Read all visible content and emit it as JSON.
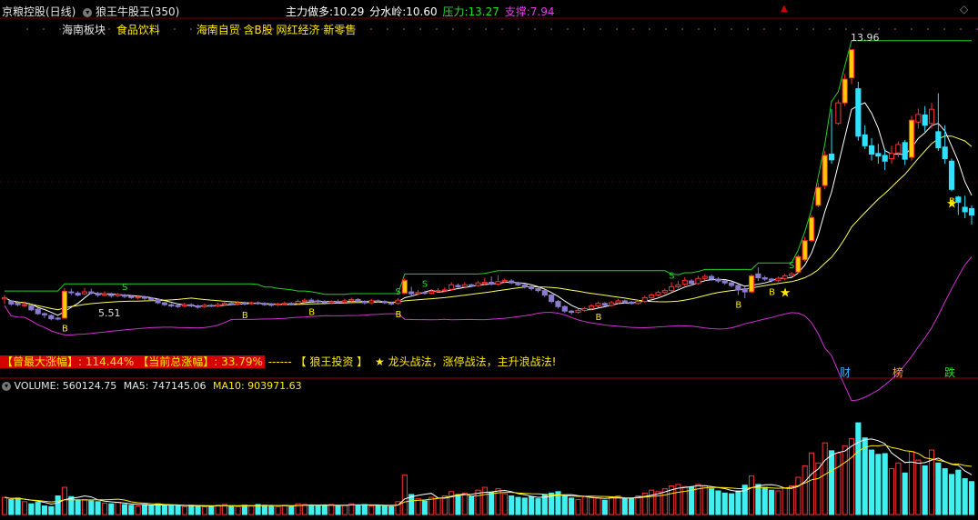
{
  "header": {
    "stock": "京粮控股(日线)",
    "indicator": "狼王牛股王(350)",
    "main_force_label": "主力做多:",
    "main_force_value": "10.29",
    "watershed_label": "分水岭:",
    "watershed_value": "10.60",
    "pressure_label": "压力:",
    "pressure_value": "13.27",
    "support_label": "支撑:",
    "support_value": "7.94",
    "colors": {
      "main_force": "#ffffff",
      "watershed": "#ffffff",
      "pressure": "#22e022",
      "support": "#e040e0"
    }
  },
  "tags": {
    "board": "海南板块",
    "sector": "食品饮料",
    "concepts": "海南自贸 含B股 网红经济 新零售"
  },
  "banner": {
    "max_gain": "【曾最大涨幅】: 114.44%",
    "cur_gain": "【当前总涨幅】: 33.79%",
    "dashes": "------",
    "brand": "【 狼王投资 】",
    "slogan": "龙头战法，涨停战法，主升浪战法!"
  },
  "markers": {
    "cai": "财",
    "bang": "榜",
    "die": "跌"
  },
  "volume_header": {
    "volume": "VOLUME: 560124.75",
    "ma5": "MA5: 747145.06",
    "ma10": "MA10: 903971.63"
  },
  "chart_data": [
    {
      "type": "candlestick",
      "title": "",
      "price_labels": {
        "high": "13.96",
        "low": "5.51"
      },
      "annotations": {
        "buy": "B",
        "sell": "S"
      },
      "ylim": [
        4.5,
        15.0
      ],
      "candles": [
        [
          6.18,
          6.22,
          6.3,
          6.02
        ],
        [
          6.12,
          6.02,
          6.15,
          5.96
        ],
        [
          6.06,
          6.0,
          6.12,
          5.95
        ],
        [
          5.98,
          6.0,
          6.1,
          5.92
        ],
        [
          5.98,
          5.84,
          6.02,
          5.8
        ],
        [
          5.86,
          5.72,
          5.9,
          5.68
        ],
        [
          5.72,
          5.68,
          5.76,
          5.58
        ],
        [
          5.66,
          5.56,
          5.7,
          5.51
        ],
        [
          5.58,
          5.55,
          5.62,
          5.51
        ],
        [
          5.58,
          6.42,
          6.52,
          5.56
        ],
        [
          6.4,
          6.38,
          6.5,
          6.3
        ],
        [
          6.36,
          6.3,
          6.42,
          6.26
        ],
        [
          6.34,
          6.4,
          6.52,
          6.3
        ],
        [
          6.4,
          6.36,
          6.5,
          6.32
        ],
        [
          6.35,
          6.3,
          6.4,
          6.24
        ],
        [
          6.3,
          6.34,
          6.42,
          6.26
        ],
        [
          6.32,
          6.28,
          6.38,
          6.22
        ],
        [
          6.28,
          6.32,
          6.36,
          6.24
        ],
        [
          6.3,
          6.26,
          6.34,
          6.2
        ],
        [
          6.26,
          6.22,
          6.3,
          6.18
        ],
        [
          6.22,
          6.24,
          6.3,
          6.16
        ],
        [
          6.24,
          6.2,
          6.28,
          6.14
        ],
        [
          6.2,
          6.16,
          6.24,
          6.1
        ],
        [
          6.16,
          6.06,
          6.2,
          6.02
        ],
        [
          6.06,
          6.0,
          6.1,
          5.96
        ],
        [
          6.0,
          5.96,
          6.04,
          5.92
        ],
        [
          5.98,
          5.94,
          6.02,
          5.9
        ],
        [
          5.96,
          6.0,
          6.06,
          5.92
        ],
        [
          6.0,
          5.96,
          6.04,
          5.92
        ],
        [
          5.96,
          5.92,
          6.0,
          5.88
        ],
        [
          5.94,
          5.98,
          6.04,
          5.9
        ],
        [
          5.98,
          5.96,
          6.02,
          5.92
        ],
        [
          5.96,
          6.0,
          6.06,
          5.92
        ],
        [
          6.0,
          6.04,
          6.1,
          5.96
        ],
        [
          6.04,
          6.02,
          6.08,
          5.98
        ],
        [
          6.02,
          6.06,
          6.12,
          5.98
        ],
        [
          6.06,
          6.02,
          6.1,
          5.98
        ],
        [
          6.04,
          6.06,
          6.1,
          6.0
        ],
        [
          6.06,
          6.04,
          6.1,
          6.0
        ],
        [
          6.04,
          6.0,
          6.08,
          5.96
        ],
        [
          6.02,
          5.98,
          6.06,
          5.94
        ],
        [
          6.0,
          6.02,
          6.06,
          5.96
        ],
        [
          6.02,
          6.04,
          6.1,
          5.98
        ],
        [
          6.04,
          6.02,
          6.08,
          5.98
        ],
        [
          6.04,
          6.1,
          6.16,
          6.0
        ],
        [
          6.1,
          6.14,
          6.2,
          6.06
        ],
        [
          6.14,
          6.12,
          6.2,
          6.08
        ],
        [
          6.12,
          6.1,
          6.16,
          6.04
        ],
        [
          6.1,
          6.06,
          6.14,
          6.0
        ],
        [
          6.06,
          6.1,
          6.14,
          6.02
        ],
        [
          6.1,
          6.08,
          6.16,
          6.04
        ],
        [
          6.08,
          6.12,
          6.18,
          6.04
        ],
        [
          6.12,
          6.16,
          6.22,
          6.08
        ],
        [
          6.16,
          6.1,
          6.2,
          6.04
        ],
        [
          6.1,
          6.06,
          6.14,
          6.0
        ],
        [
          6.06,
          6.12,
          6.18,
          6.02
        ],
        [
          6.12,
          6.1,
          6.16,
          6.06
        ],
        [
          6.1,
          6.06,
          6.14,
          6.02
        ],
        [
          6.06,
          6.02,
          6.1,
          5.98
        ],
        [
          6.04,
          6.14,
          6.2,
          6.0
        ],
        [
          6.36,
          6.76,
          6.82,
          6.34
        ],
        [
          6.4,
          6.34,
          6.56,
          6.28
        ],
        [
          6.34,
          6.38,
          6.46,
          6.3
        ],
        [
          6.38,
          6.36,
          6.44,
          6.32
        ],
        [
          6.36,
          6.42,
          6.48,
          6.32
        ],
        [
          6.42,
          6.44,
          6.52,
          6.38
        ],
        [
          6.44,
          6.46,
          6.54,
          6.4
        ],
        [
          6.48,
          6.62,
          6.7,
          6.44
        ],
        [
          6.6,
          6.56,
          6.66,
          6.52
        ],
        [
          6.56,
          6.62,
          6.7,
          6.52
        ],
        [
          6.62,
          6.58,
          6.66,
          6.54
        ],
        [
          6.6,
          6.68,
          6.74,
          6.56
        ],
        [
          6.66,
          6.7,
          6.84,
          6.62
        ],
        [
          6.7,
          6.64,
          6.88,
          6.6
        ],
        [
          6.64,
          6.72,
          6.92,
          6.6
        ],
        [
          6.72,
          6.76,
          6.82,
          6.68
        ],
        [
          6.74,
          6.68,
          6.8,
          6.64
        ],
        [
          6.68,
          6.62,
          6.72,
          6.58
        ],
        [
          6.62,
          6.56,
          6.66,
          6.5
        ],
        [
          6.56,
          6.5,
          6.6,
          6.44
        ],
        [
          6.5,
          6.44,
          6.54,
          6.38
        ],
        [
          6.44,
          6.3,
          6.48,
          6.24
        ],
        [
          6.3,
          6.1,
          6.34,
          6.04
        ],
        [
          6.1,
          5.94,
          6.14,
          5.88
        ],
        [
          5.94,
          5.8,
          5.98,
          5.74
        ],
        [
          5.8,
          5.76,
          5.84,
          5.7
        ],
        [
          5.76,
          5.82,
          5.88,
          5.72
        ],
        [
          5.82,
          5.88,
          5.94,
          5.78
        ],
        [
          5.88,
          5.96,
          6.02,
          5.84
        ],
        [
          5.96,
          6.04,
          6.1,
          5.92
        ],
        [
          6.04,
          5.98,
          6.08,
          5.94
        ],
        [
          5.98,
          6.06,
          6.12,
          5.94
        ],
        [
          6.06,
          6.12,
          6.18,
          6.02
        ],
        [
          6.12,
          6.08,
          6.16,
          6.04
        ],
        [
          6.08,
          6.04,
          6.12,
          6.0
        ],
        [
          6.04,
          6.1,
          6.16,
          6.0
        ],
        [
          6.1,
          6.22,
          6.28,
          6.06
        ],
        [
          6.22,
          6.3,
          6.36,
          6.18
        ],
        [
          6.3,
          6.38,
          6.44,
          6.26
        ],
        [
          6.38,
          6.44,
          6.5,
          6.34
        ],
        [
          6.44,
          6.56,
          6.7,
          6.4
        ],
        [
          6.56,
          6.62,
          6.74,
          6.5
        ],
        [
          6.64,
          6.76,
          6.86,
          6.58
        ],
        [
          6.74,
          6.66,
          6.8,
          6.6
        ],
        [
          6.66,
          6.82,
          6.9,
          6.62
        ],
        [
          6.82,
          6.88,
          6.96,
          6.76
        ],
        [
          6.88,
          6.8,
          6.94,
          6.74
        ],
        [
          6.8,
          6.74,
          6.86,
          6.68
        ],
        [
          6.74,
          6.68,
          6.78,
          6.62
        ],
        [
          6.68,
          6.6,
          6.72,
          6.54
        ],
        [
          6.6,
          6.46,
          6.64,
          6.3
        ],
        [
          6.5,
          6.4,
          6.56,
          6.2
        ],
        [
          6.4,
          6.9,
          6.96,
          6.36
        ],
        [
          6.96,
          6.84,
          7.16,
          6.74
        ],
        [
          6.84,
          6.8,
          6.9,
          6.74
        ],
        [
          6.8,
          6.76,
          6.84,
          6.7
        ],
        [
          6.76,
          6.82,
          6.88,
          6.7
        ],
        [
          6.82,
          6.9,
          6.96,
          6.76
        ],
        [
          6.9,
          6.96,
          7.02,
          6.86
        ],
        [
          7.02,
          7.5,
          7.56,
          6.98
        ],
        [
          7.4,
          8.0,
          8.12,
          7.34
        ],
        [
          8.0,
          8.72,
          8.8,
          7.96
        ],
        [
          9.1,
          9.66,
          9.8,
          9.04
        ],
        [
          9.72,
          10.66,
          10.8,
          9.6
        ],
        [
          10.7,
          10.52,
          12.1,
          10.4
        ],
        [
          11.66,
          12.3,
          12.4,
          11.62
        ],
        [
          12.3,
          13.04,
          13.2,
          12.2
        ],
        [
          13.08,
          13.96,
          13.96,
          12.88
        ],
        [
          12.74,
          11.26,
          12.96,
          11.12
        ],
        [
          11.3,
          10.96,
          11.6,
          10.86
        ],
        [
          10.96,
          10.7,
          11.2,
          10.5
        ],
        [
          10.72,
          10.64,
          11.02,
          10.4
        ],
        [
          10.66,
          10.48,
          10.86,
          10.2
        ],
        [
          10.56,
          10.72,
          10.96,
          10.4
        ],
        [
          10.74,
          11.0,
          11.1,
          10.6
        ],
        [
          11.06,
          10.54,
          11.14,
          10.36
        ],
        [
          10.6,
          11.76,
          11.9,
          10.5
        ],
        [
          11.7,
          11.94,
          12.12,
          11.5
        ],
        [
          11.92,
          11.6,
          12.2,
          11.4
        ],
        [
          11.66,
          12.1,
          12.3,
          11.5
        ],
        [
          11.4,
          10.9,
          12.6,
          10.8
        ],
        [
          10.92,
          10.56,
          11.6,
          10.4
        ],
        [
          10.48,
          9.6,
          10.56,
          9.54
        ],
        [
          9.36,
          9.2,
          9.4,
          8.8
        ],
        [
          9.04,
          8.9,
          9.4,
          8.7
        ],
        [
          9.0,
          8.8,
          9.1,
          8.5
        ]
      ]
    },
    {
      "type": "bar",
      "title": "",
      "series_lines": [
        "MA5",
        "MA10"
      ],
      "ylim": [
        0,
        1700000
      ],
      "volumes": [
        240,
        210,
        230,
        180,
        150,
        170,
        120,
        110,
        260,
        380,
        250,
        200,
        210,
        190,
        180,
        160,
        150,
        170,
        140,
        130,
        120,
        140,
        130,
        150,
        120,
        130,
        120,
        110,
        130,
        120,
        110,
        120,
        130,
        140,
        120,
        110,
        130,
        120,
        140,
        130,
        120,
        110,
        130,
        120,
        150,
        140,
        130,
        120,
        130,
        140,
        120,
        130,
        150,
        130,
        140,
        120,
        130,
        120,
        110,
        180,
        550,
        280,
        220,
        190,
        240,
        230,
        260,
        320,
        280,
        300,
        250,
        340,
        380,
        310,
        360,
        290,
        260,
        240,
        230,
        250,
        220,
        280,
        300,
        320,
        260,
        230,
        210,
        250,
        240,
        230,
        200,
        240,
        260,
        220,
        230,
        260,
        300,
        340,
        320,
        360,
        400,
        420,
        390,
        380,
        420,
        400,
        360,
        330,
        300,
        290,
        330,
        410,
        540,
        420,
        380,
        340,
        330,
        370,
        400,
        520,
        680,
        860,
        720,
        1000,
        890,
        860,
        960,
        1060,
        1280,
        1070,
        900,
        840,
        850,
        640,
        720,
        580,
        880,
        760,
        680,
        900,
        720,
        640,
        560,
        620,
        500,
        460
      ]
    }
  ]
}
